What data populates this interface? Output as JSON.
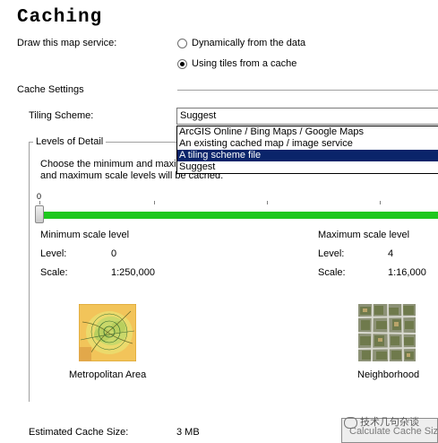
{
  "title": "Caching",
  "draw": {
    "label": "Draw this map service:",
    "option_dynamic": "Dynamically from the data",
    "option_cache": "Using tiles from a cache",
    "selected": "cache"
  },
  "cache_settings": {
    "label": "Cache Settings",
    "tiling_label": "Tiling Scheme:",
    "tiling_value": "Suggest",
    "dropdown_options": [
      "ArcGIS Online / Bing Maps / Google Maps",
      "An existing cached map / image service",
      "A tiling scheme file",
      "Suggest"
    ],
    "dropdown_highlighted": "A tiling scheme file"
  },
  "lod": {
    "legend": "Levels of Detail",
    "instructions_line1": "Choose the minimum and maxim",
    "instructions_line2": "and maximum scale levels will be cached.",
    "slider_tick_label": "0",
    "slider_min_level": 0,
    "slider_max_level": 4,
    "min": {
      "heading": "Minimum scale level",
      "level_label": "Level:",
      "level_value": "0",
      "scale_label": "Scale:",
      "scale_value": "1:250,000",
      "caption": "Metropolitan Area"
    },
    "max": {
      "heading": "Maximum scale level",
      "level_label": "Level:",
      "level_value": "4",
      "scale_label": "Scale:",
      "scale_value": "1:16,000",
      "caption": "Neighborhood"
    }
  },
  "estimate": {
    "label": "Estimated Cache Size:",
    "value": "3 MB",
    "button": "Calculate Cache Size"
  },
  "watermark": "技术几句杂谈",
  "colors": {
    "slider_track": "#1ec81e",
    "selection": "#0a246a"
  }
}
